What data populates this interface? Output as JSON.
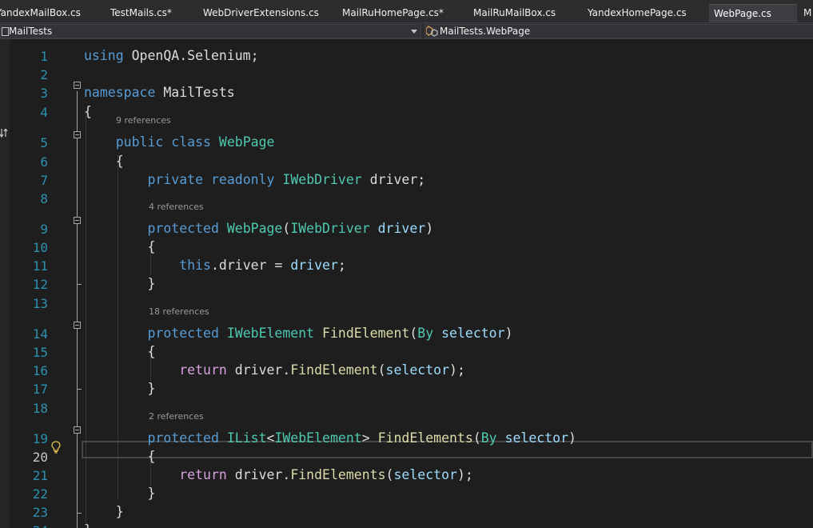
{
  "tabs": [
    {
      "label": "YandexMailBox.cs",
      "active": false
    },
    {
      "label": "TestMails.cs*",
      "active": false
    },
    {
      "label": "WebDriverExtensions.cs",
      "active": false
    },
    {
      "label": "MailRuHomePage.cs*",
      "active": false
    },
    {
      "label": "MailRuMailBox.cs",
      "active": false
    },
    {
      "label": "YandexHomePage.cs",
      "active": false
    },
    {
      "label": "WebPage.cs",
      "active": true
    },
    {
      "label": "M",
      "active": false
    }
  ],
  "nav": {
    "project": "MailTests",
    "member": "MailTests.WebPage"
  },
  "editor": {
    "current_line": 20,
    "codelens": [
      "9 references",
      "4 references",
      "18 references",
      "2 references"
    ],
    "lines": [
      {
        "n": 1,
        "tokens": [
          [
            "using",
            "kw"
          ],
          [
            " OpenQA.Selenium;",
            ""
          ]
        ]
      },
      {
        "n": 2,
        "tokens": []
      },
      {
        "n": 3,
        "tokens": [
          [
            "namespace",
            "kw"
          ],
          [
            " MailTests",
            ""
          ]
        ]
      },
      {
        "n": 4,
        "tokens": [
          [
            "{",
            ""
          ]
        ]
      },
      {
        "n": 5,
        "tokens": [
          [
            "    ",
            ""
          ],
          [
            "public",
            "kw"
          ],
          [
            " ",
            ""
          ],
          [
            "class",
            "kw"
          ],
          [
            " ",
            ""
          ],
          [
            "WebPage",
            "ty"
          ]
        ]
      },
      {
        "n": 6,
        "tokens": [
          [
            "    {",
            ""
          ]
        ]
      },
      {
        "n": 7,
        "tokens": [
          [
            "        ",
            ""
          ],
          [
            "private",
            "kw"
          ],
          [
            " ",
            ""
          ],
          [
            "readonly",
            "kw"
          ],
          [
            " ",
            ""
          ],
          [
            "IWebDriver",
            "ty"
          ],
          [
            " driver;",
            ""
          ]
        ]
      },
      {
        "n": 8,
        "tokens": []
      },
      {
        "n": 9,
        "tokens": [
          [
            "        ",
            ""
          ],
          [
            "protected",
            "kw"
          ],
          [
            " ",
            ""
          ],
          [
            "WebPage",
            "ty"
          ],
          [
            "(",
            ""
          ],
          [
            "IWebDriver",
            "ty"
          ],
          [
            " ",
            ""
          ],
          [
            "driver",
            "pm"
          ],
          [
            ")",
            ""
          ]
        ]
      },
      {
        "n": 10,
        "tokens": [
          [
            "        {",
            ""
          ]
        ]
      },
      {
        "n": 11,
        "tokens": [
          [
            "            ",
            ""
          ],
          [
            "this",
            "kw"
          ],
          [
            ".driver = ",
            ""
          ],
          [
            "driver",
            "pm"
          ],
          [
            ";",
            ""
          ]
        ]
      },
      {
        "n": 12,
        "tokens": [
          [
            "        }",
            ""
          ]
        ]
      },
      {
        "n": 13,
        "tokens": []
      },
      {
        "n": 14,
        "tokens": [
          [
            "        ",
            ""
          ],
          [
            "protected",
            "kw"
          ],
          [
            " ",
            ""
          ],
          [
            "IWebElement",
            "ty"
          ],
          [
            " ",
            ""
          ],
          [
            "FindElement",
            "mt"
          ],
          [
            "(",
            ""
          ],
          [
            "By",
            "ty"
          ],
          [
            " ",
            ""
          ],
          [
            "selector",
            "pm"
          ],
          [
            ")",
            ""
          ]
        ]
      },
      {
        "n": 15,
        "tokens": [
          [
            "        {",
            ""
          ]
        ]
      },
      {
        "n": 16,
        "tokens": [
          [
            "            ",
            ""
          ],
          [
            "return",
            "ctl"
          ],
          [
            " driver.",
            ""
          ],
          [
            "FindElement",
            "mt"
          ],
          [
            "(",
            ""
          ],
          [
            "selector",
            "pm"
          ],
          [
            ");",
            ""
          ]
        ]
      },
      {
        "n": 17,
        "tokens": [
          [
            "        }",
            ""
          ]
        ]
      },
      {
        "n": 18,
        "tokens": []
      },
      {
        "n": 19,
        "tokens": [
          [
            "        ",
            ""
          ],
          [
            "protected",
            "kw"
          ],
          [
            " ",
            ""
          ],
          [
            "IList",
            "ty"
          ],
          [
            "<",
            ""
          ],
          [
            "IWebElement",
            "ty"
          ],
          [
            "> ",
            ""
          ],
          [
            "FindElements",
            "mt"
          ],
          [
            "(",
            ""
          ],
          [
            "By",
            "ty"
          ],
          [
            " ",
            ""
          ],
          [
            "selector",
            "pm"
          ],
          [
            ")",
            ""
          ]
        ]
      },
      {
        "n": 20,
        "tokens": [
          [
            "        {",
            ""
          ]
        ]
      },
      {
        "n": 21,
        "tokens": [
          [
            "            ",
            ""
          ],
          [
            "return",
            "ctl"
          ],
          [
            " driver.",
            ""
          ],
          [
            "FindElements",
            "mt"
          ],
          [
            "(",
            ""
          ],
          [
            "selector",
            "pm"
          ],
          [
            ");",
            ""
          ]
        ]
      },
      {
        "n": 22,
        "tokens": [
          [
            "        }",
            ""
          ]
        ]
      },
      {
        "n": 23,
        "tokens": [
          [
            "    }",
            ""
          ]
        ]
      },
      {
        "n": 24,
        "tokens": [
          [
            "}",
            ""
          ]
        ]
      }
    ]
  }
}
